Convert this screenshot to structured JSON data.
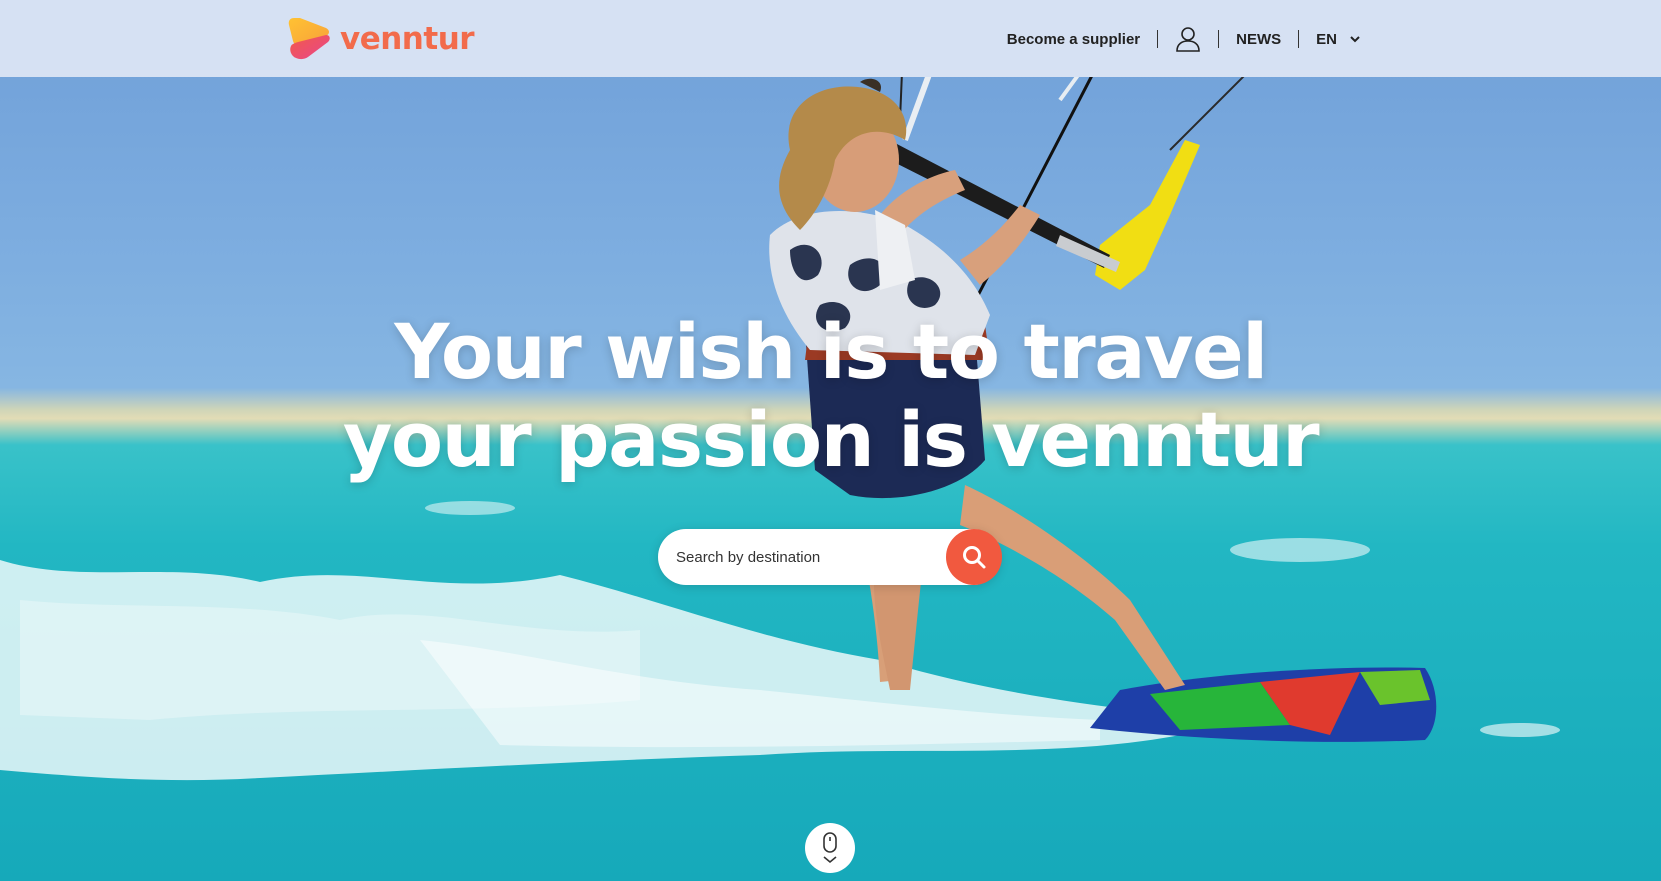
{
  "brand": {
    "name": "venntur",
    "primary_color": "#f26b4b",
    "logo_colors": [
      "#ffc233",
      "#f25a4a",
      "#e8468c"
    ]
  },
  "header": {
    "background": "#d6e1f3",
    "nav": {
      "supplier_label": "Become a supplier",
      "account_icon": "user-icon",
      "news_label": "NEWS",
      "language_label": "EN",
      "language_icon": "chevron-down-icon"
    }
  },
  "hero": {
    "headline_line1": "Your wish is to travel",
    "headline_line2": "your passion is venntur",
    "background_image": "kitesurfer on turquoise sea"
  },
  "search": {
    "placeholder": "Search by destination",
    "button_icon": "search-icon",
    "button_color": "#f1593f"
  },
  "scroll_hint": {
    "icon": "mouse-scroll-icon"
  }
}
